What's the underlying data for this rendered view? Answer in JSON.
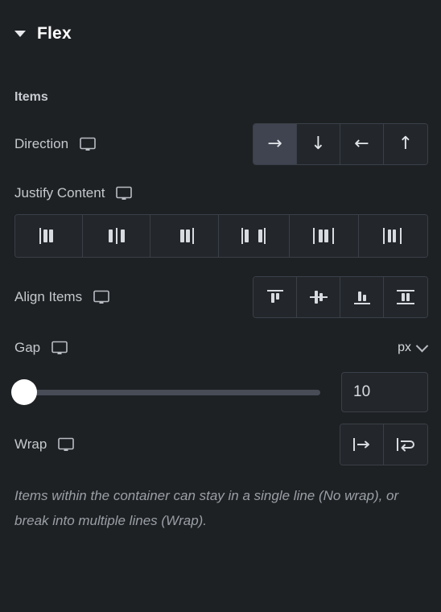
{
  "section": {
    "title": "Flex",
    "collapse_icon": "caret-down-icon",
    "expanded": true
  },
  "items_heading": "Items",
  "controls": {
    "direction": {
      "label": "Direction",
      "device_icon": "monitor-icon",
      "selected_index": 0,
      "options": [
        {
          "value": "row",
          "glyph": "→",
          "name": "arrow-right-icon"
        },
        {
          "value": "column",
          "glyph": "↓",
          "name": "arrow-down-icon"
        },
        {
          "value": "row-reverse",
          "glyph": "←",
          "name": "arrow-left-icon"
        },
        {
          "value": "column-reverse",
          "glyph": "↑",
          "name": "arrow-up-icon"
        }
      ]
    },
    "justify_content": {
      "label": "Justify Content",
      "device_icon": "monitor-icon",
      "selected_index": -1,
      "options": [
        {
          "value": "flex-start",
          "name": "justify-start-icon"
        },
        {
          "value": "center",
          "name": "justify-center-icon"
        },
        {
          "value": "flex-end",
          "name": "justify-end-icon"
        },
        {
          "value": "space-between",
          "name": "justify-space-between-icon"
        },
        {
          "value": "space-around",
          "name": "justify-space-around-icon"
        },
        {
          "value": "space-evenly",
          "name": "justify-space-evenly-icon"
        }
      ]
    },
    "align_items": {
      "label": "Align Items",
      "device_icon": "monitor-icon",
      "selected_index": -1,
      "options": [
        {
          "value": "flex-start",
          "name": "align-start-icon"
        },
        {
          "value": "center",
          "name": "align-center-icon"
        },
        {
          "value": "flex-end",
          "name": "align-end-icon"
        },
        {
          "value": "stretch",
          "name": "align-stretch-icon"
        }
      ]
    },
    "gap": {
      "label": "Gap",
      "device_icon": "monitor-icon",
      "unit": "px",
      "unit_chevron": "chevron-down-icon",
      "value": "10",
      "slider_percent": 0,
      "slider_min": 0,
      "slider_max": 100
    },
    "wrap": {
      "label": "Wrap",
      "device_icon": "monitor-icon",
      "selected_index": -1,
      "options": [
        {
          "value": "nowrap",
          "name": "no-wrap-icon"
        },
        {
          "value": "wrap",
          "name": "wrap-icon"
        }
      ],
      "description": "Items within the container can stay in a single line (No wrap), or break into multiple lines (Wrap)."
    }
  },
  "colors": {
    "panel_background": "#1e2124",
    "control_background": "#23262b",
    "control_border": "#3a4048",
    "selected_background": "#3f4450",
    "text_primary": "#ffffff",
    "text_secondary": "#c5c9cd",
    "text_muted": "#9aa0a6",
    "slider_track": "#474c57",
    "slider_thumb": "#ffffff"
  }
}
